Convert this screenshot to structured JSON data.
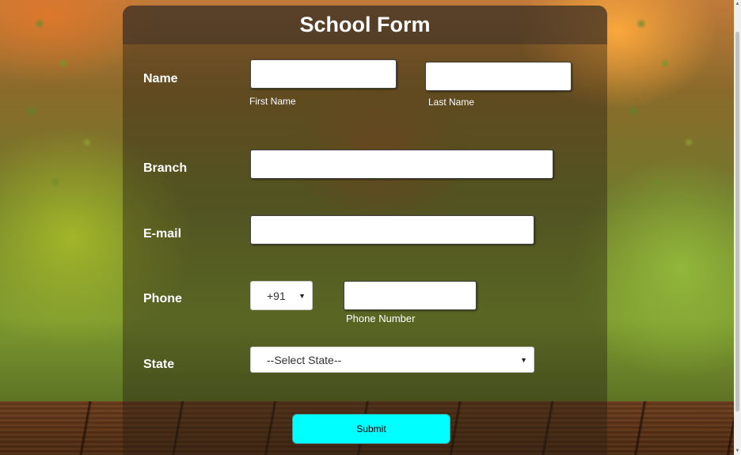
{
  "form": {
    "title": "School Form",
    "name_label": "Name",
    "first_name_caption": "First Name",
    "last_name_caption": "Last Name",
    "branch_label": "Branch",
    "email_label": "E-mail",
    "phone_label": "Phone",
    "country_code": "+91",
    "phone_number_caption": "Phone Number",
    "state_label": "State",
    "state_select": "--Select State--",
    "submit_label": "Submit"
  },
  "colors": {
    "submit_bg": "#00ffff",
    "text": "#ffffff"
  },
  "icons": {
    "select_arrow": "chevron-down-icon"
  }
}
